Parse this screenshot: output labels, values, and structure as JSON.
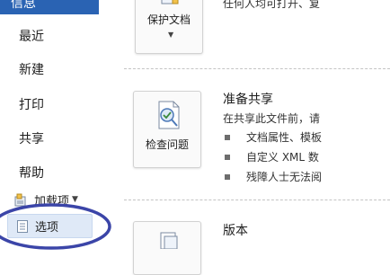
{
  "sidebar": {
    "top_item": "信息",
    "items": [
      "最近",
      "新建",
      "打印",
      "共享",
      "帮助"
    ],
    "addins": "加载项",
    "options": "选项"
  },
  "sections": [
    {
      "button_label": "保护文档",
      "title_partial": "任何人均可打开、复"
    },
    {
      "button_label": "检查问题",
      "title": "准备共享",
      "description": "在共享此文件前，请",
      "bullets": [
        "文档属性、模板",
        "自定义 XML 数",
        "残障人士无法阅"
      ]
    },
    {
      "title": "版本"
    }
  ],
  "colors": {
    "accent": "#2a63b3",
    "highlight_ellipse": "#3b45a8",
    "selected_item_bg": "#dfe9f7"
  }
}
